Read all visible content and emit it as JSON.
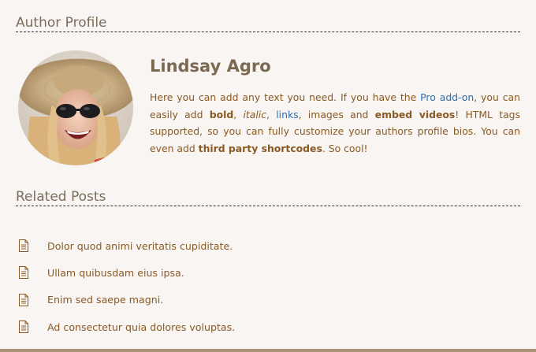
{
  "author_section": {
    "heading": "Author Profile",
    "name": "Lindsay Agro",
    "bio": {
      "t1": "Here you can add any text you need. If you have the ",
      "link1": "Pro add-on",
      "t2": ", you can easily add ",
      "bold1": "bold",
      "t3": ", ",
      "italic1": "italic",
      "t4": ", ",
      "link2": "links",
      "t5": ", images and ",
      "bold2": "embed videos",
      "t6": "! HTML tags supported, so you can fully customize your authors profile bios. You can even add ",
      "bold3": "third party shortcodes",
      "t7": ". So cool!"
    }
  },
  "related_section": {
    "heading": "Related Posts",
    "posts": [
      {
        "title": "Dolor quod animi veritatis cupiditate."
      },
      {
        "title": "Ullam quibusdam eius ipsa."
      },
      {
        "title": "Enim sed saepe magni."
      },
      {
        "title": "Ad consectetur quia dolores voluptas."
      }
    ]
  },
  "icons": {
    "post": "document-icon",
    "avatar": "author-photo"
  },
  "colors": {
    "background": "#f8f5f3",
    "heading": "#7b6e5d",
    "text": "#8a5a22",
    "link": "#2a6fb0",
    "footer_bar": "#a89378"
  }
}
